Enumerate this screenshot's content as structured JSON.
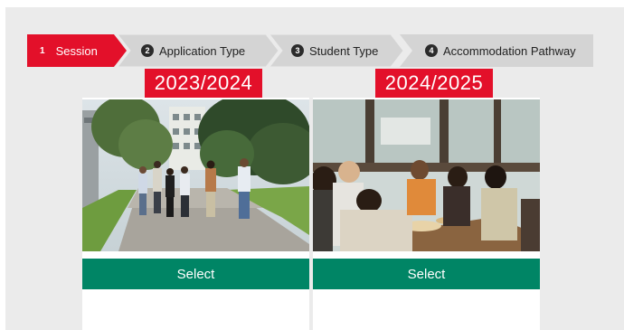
{
  "stepper": {
    "steps": [
      {
        "number": "1",
        "label": "Session",
        "active": true
      },
      {
        "number": "2",
        "label": "Application Type",
        "active": false
      },
      {
        "number": "3",
        "label": "Student Type",
        "active": false
      },
      {
        "number": "4",
        "label": "Accommodation Pathway",
        "active": false
      }
    ]
  },
  "sessions": [
    {
      "year": "2023/2024",
      "select_label": "Select"
    },
    {
      "year": "2024/2025",
      "select_label": "Select"
    }
  ],
  "colors": {
    "accent_red": "#e3102a",
    "select_green": "#008565",
    "step_inactive": "#d4d4d4",
    "page_bg": "#ebebeb"
  }
}
